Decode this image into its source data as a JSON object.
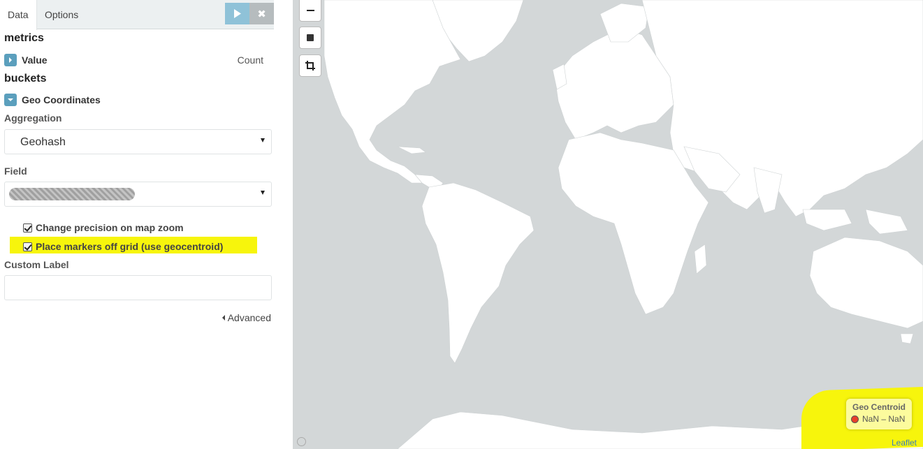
{
  "tabs": [
    {
      "label": "Data",
      "active": true
    },
    {
      "label": "Options",
      "active": false
    }
  ],
  "toolbar": {
    "apply_icon": "play-icon",
    "discard_icon": "close-icon",
    "discard_glyph": "✖"
  },
  "metrics": {
    "title": "metrics",
    "items": [
      {
        "label": "Value",
        "right": "Count",
        "icon": "chevron-right-icon"
      }
    ]
  },
  "buckets": {
    "title": "buckets",
    "items": [
      {
        "label": "Geo Coordinates",
        "icon": "chevron-down-icon"
      }
    ]
  },
  "form": {
    "aggregation_label": "Aggregation",
    "aggregation_value": "Geohash",
    "field_label": "Field",
    "field_value_redacted": true,
    "precision_label": "Change precision on map zoom",
    "precision_checked": true,
    "geocentroid_label": "Place markers off grid (use geocentroid)",
    "geocentroid_checked": true,
    "custom_label_label": "Custom Label",
    "custom_label_value": "",
    "advanced_label": "Advanced"
  },
  "map": {
    "controls": [
      "zoom-out-icon",
      "rectangle-draw-icon",
      "crop-icon"
    ],
    "legend": {
      "title": "Geo Centroid",
      "entry": "NaN – NaN",
      "color": "#e8402a"
    },
    "attribution": "Leaflet",
    "land_color": "#ffffff",
    "water_color": "#d3d7d8",
    "highlight_color": "#f7f50c"
  }
}
